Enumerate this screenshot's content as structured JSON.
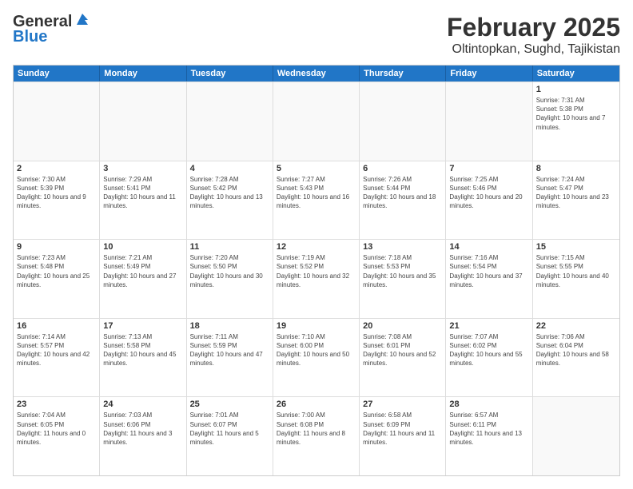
{
  "header": {
    "logo": {
      "line1": "General",
      "line2": "Blue"
    },
    "title": "February 2025",
    "subtitle": "Oltintopkan, Sughd, Tajikistan"
  },
  "days_of_week": [
    "Sunday",
    "Monday",
    "Tuesday",
    "Wednesday",
    "Thursday",
    "Friday",
    "Saturday"
  ],
  "weeks": [
    [
      {
        "day": "",
        "info": ""
      },
      {
        "day": "",
        "info": ""
      },
      {
        "day": "",
        "info": ""
      },
      {
        "day": "",
        "info": ""
      },
      {
        "day": "",
        "info": ""
      },
      {
        "day": "",
        "info": ""
      },
      {
        "day": "1",
        "info": "Sunrise: 7:31 AM\nSunset: 5:38 PM\nDaylight: 10 hours and 7 minutes."
      }
    ],
    [
      {
        "day": "2",
        "info": "Sunrise: 7:30 AM\nSunset: 5:39 PM\nDaylight: 10 hours and 9 minutes."
      },
      {
        "day": "3",
        "info": "Sunrise: 7:29 AM\nSunset: 5:41 PM\nDaylight: 10 hours and 11 minutes."
      },
      {
        "day": "4",
        "info": "Sunrise: 7:28 AM\nSunset: 5:42 PM\nDaylight: 10 hours and 13 minutes."
      },
      {
        "day": "5",
        "info": "Sunrise: 7:27 AM\nSunset: 5:43 PM\nDaylight: 10 hours and 16 minutes."
      },
      {
        "day": "6",
        "info": "Sunrise: 7:26 AM\nSunset: 5:44 PM\nDaylight: 10 hours and 18 minutes."
      },
      {
        "day": "7",
        "info": "Sunrise: 7:25 AM\nSunset: 5:46 PM\nDaylight: 10 hours and 20 minutes."
      },
      {
        "day": "8",
        "info": "Sunrise: 7:24 AM\nSunset: 5:47 PM\nDaylight: 10 hours and 23 minutes."
      }
    ],
    [
      {
        "day": "9",
        "info": "Sunrise: 7:23 AM\nSunset: 5:48 PM\nDaylight: 10 hours and 25 minutes."
      },
      {
        "day": "10",
        "info": "Sunrise: 7:21 AM\nSunset: 5:49 PM\nDaylight: 10 hours and 27 minutes."
      },
      {
        "day": "11",
        "info": "Sunrise: 7:20 AM\nSunset: 5:50 PM\nDaylight: 10 hours and 30 minutes."
      },
      {
        "day": "12",
        "info": "Sunrise: 7:19 AM\nSunset: 5:52 PM\nDaylight: 10 hours and 32 minutes."
      },
      {
        "day": "13",
        "info": "Sunrise: 7:18 AM\nSunset: 5:53 PM\nDaylight: 10 hours and 35 minutes."
      },
      {
        "day": "14",
        "info": "Sunrise: 7:16 AM\nSunset: 5:54 PM\nDaylight: 10 hours and 37 minutes."
      },
      {
        "day": "15",
        "info": "Sunrise: 7:15 AM\nSunset: 5:55 PM\nDaylight: 10 hours and 40 minutes."
      }
    ],
    [
      {
        "day": "16",
        "info": "Sunrise: 7:14 AM\nSunset: 5:57 PM\nDaylight: 10 hours and 42 minutes."
      },
      {
        "day": "17",
        "info": "Sunrise: 7:13 AM\nSunset: 5:58 PM\nDaylight: 10 hours and 45 minutes."
      },
      {
        "day": "18",
        "info": "Sunrise: 7:11 AM\nSunset: 5:59 PM\nDaylight: 10 hours and 47 minutes."
      },
      {
        "day": "19",
        "info": "Sunrise: 7:10 AM\nSunset: 6:00 PM\nDaylight: 10 hours and 50 minutes."
      },
      {
        "day": "20",
        "info": "Sunrise: 7:08 AM\nSunset: 6:01 PM\nDaylight: 10 hours and 52 minutes."
      },
      {
        "day": "21",
        "info": "Sunrise: 7:07 AM\nSunset: 6:02 PM\nDaylight: 10 hours and 55 minutes."
      },
      {
        "day": "22",
        "info": "Sunrise: 7:06 AM\nSunset: 6:04 PM\nDaylight: 10 hours and 58 minutes."
      }
    ],
    [
      {
        "day": "23",
        "info": "Sunrise: 7:04 AM\nSunset: 6:05 PM\nDaylight: 11 hours and 0 minutes."
      },
      {
        "day": "24",
        "info": "Sunrise: 7:03 AM\nSunset: 6:06 PM\nDaylight: 11 hours and 3 minutes."
      },
      {
        "day": "25",
        "info": "Sunrise: 7:01 AM\nSunset: 6:07 PM\nDaylight: 11 hours and 5 minutes."
      },
      {
        "day": "26",
        "info": "Sunrise: 7:00 AM\nSunset: 6:08 PM\nDaylight: 11 hours and 8 minutes."
      },
      {
        "day": "27",
        "info": "Sunrise: 6:58 AM\nSunset: 6:09 PM\nDaylight: 11 hours and 11 minutes."
      },
      {
        "day": "28",
        "info": "Sunrise: 6:57 AM\nSunset: 6:11 PM\nDaylight: 11 hours and 13 minutes."
      },
      {
        "day": "",
        "info": ""
      }
    ]
  ]
}
